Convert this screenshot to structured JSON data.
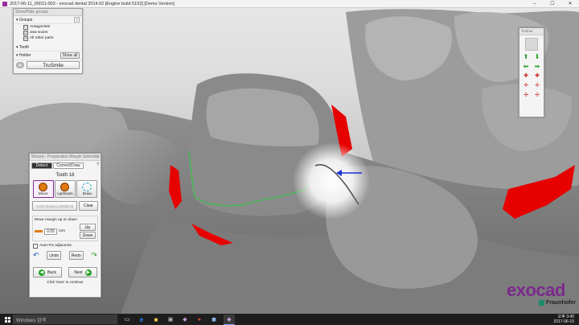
{
  "window": {
    "title": "2017-06-11_00011-003 - exocad dental 2014.02 [Engine build 5153] [Demo Version]",
    "minimize": "–",
    "maximize": "☐",
    "close": "✕"
  },
  "show_hide": {
    "title": "Show/Hide groups",
    "groups_label": "Groups",
    "help": "?",
    "items": [
      {
        "label": "Antagonists",
        "checked": "☐"
      },
      {
        "label": "Jaw scans",
        "checked": "☑"
      },
      {
        "label": "All other parts",
        "checked": "☑"
      }
    ],
    "tooth_label": "Tooth",
    "holder_label": "Holder",
    "show_all": "Show all",
    "brand_button": "TruSmile"
  },
  "wizard": {
    "title": "Wizard - Preparation Margin Selection",
    "tabs": [
      "Detect",
      "Correct/Draw"
    ],
    "tooth_label": "Tooth 16",
    "tools": [
      {
        "label": "Move",
        "icon": "move-icon"
      },
      {
        "label": "Up/Down",
        "icon": "updown-icon"
      },
      {
        "label": "Draw",
        "icon": "draw-icon"
      }
    ],
    "mode_button": "Assist drawing (disabled)",
    "clear_button": "Clear",
    "move_margin_label": "Move margin up or down",
    "move_value": "0.05",
    "move_unit": "mm",
    "up_button": "Up",
    "down_button": "Down",
    "autofix_label": "Auto-Fix adjacents",
    "undo_button": "Undo",
    "redo_button": "Redo",
    "back_button": "Back",
    "next_button": "Next",
    "hint": "Click 'Next' to continue"
  },
  "toolbar": {
    "title": "Toolbar"
  },
  "brand": {
    "name": "exocad",
    "sub": "Fraunhofer"
  },
  "taskbar": {
    "search_placeholder": "Windows 검색",
    "time": "오후 3:40",
    "date": "2017-06-15"
  },
  "colors": {
    "margin_line": "#2ecc40",
    "cavity_red": "#e60000",
    "accent": "#7b2a8c"
  }
}
